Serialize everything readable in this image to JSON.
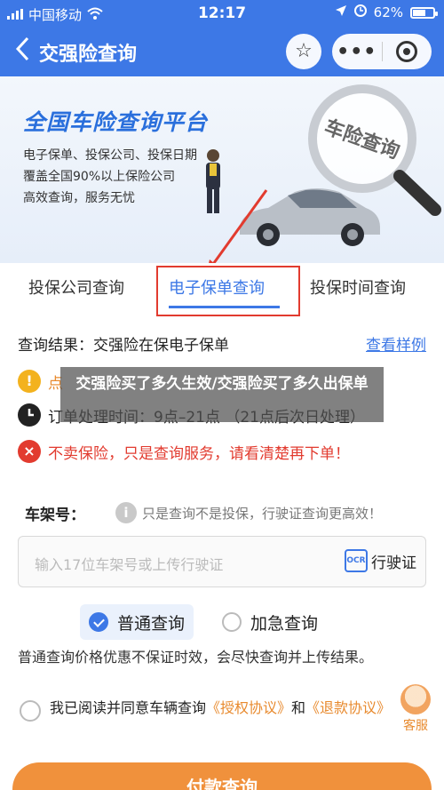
{
  "status_bar": {
    "carrier": "中国移动",
    "time": "12:17",
    "battery": "62%"
  },
  "nav": {
    "back_icon": "chevron-left-icon",
    "title": "交强险查询",
    "favorite_icon": "star-icon",
    "more_icon": "more-dots-icon",
    "close_icon": "target-close-icon"
  },
  "banner": {
    "title": "全国车险查询平台",
    "lines": [
      "电子保单、投保公司、投保日期",
      "覆盖全国90%以上保险公司",
      "高效查询，服务无忧"
    ],
    "lens_text": "车险查询"
  },
  "tabs": [
    {
      "label": "投保公司查询",
      "active": false
    },
    {
      "label": "电子保单查询",
      "active": true
    },
    {
      "label": "投保时间查询",
      "active": false
    }
  ],
  "result": {
    "label": "查询结果：交强险在保电子保单",
    "sample_link": "查看样例"
  },
  "notices": [
    {
      "icon": "!",
      "text": "点"
    },
    {
      "icon": "clock",
      "text": "订单处理时间：9点–21点 （21点后次日处理）"
    },
    {
      "icon": "×",
      "text": "不卖保险，只是查询服务，请看清楚再下单！"
    }
  ],
  "overlay_title": "交强险买了多久生效/交强险买了多久出保单",
  "vin": {
    "label": "车架号：",
    "hint": "只是查询不是投保，行驶证查询更高效！",
    "placeholder": "输入17位车架号或上传行驶证",
    "ocr_label": "行驶证",
    "ocr_icon_text": "OCR"
  },
  "query_types": [
    {
      "label": "普通查询",
      "selected": true
    },
    {
      "label": "加急查询",
      "selected": false
    }
  ],
  "description": "普通查询价格优惠不保证时效，会尽快查询并上传结果。",
  "agreement": {
    "prefix": "我已阅读并同意车辆查询",
    "link1": "《授权协议》",
    "and": "和",
    "link2": "《退款协议》"
  },
  "customer_service": {
    "label": "客服"
  },
  "pay_button": "付款查询",
  "colors": {
    "primary": "#3d78e6",
    "accent": "#f0913c",
    "danger": "#e23b2f"
  }
}
